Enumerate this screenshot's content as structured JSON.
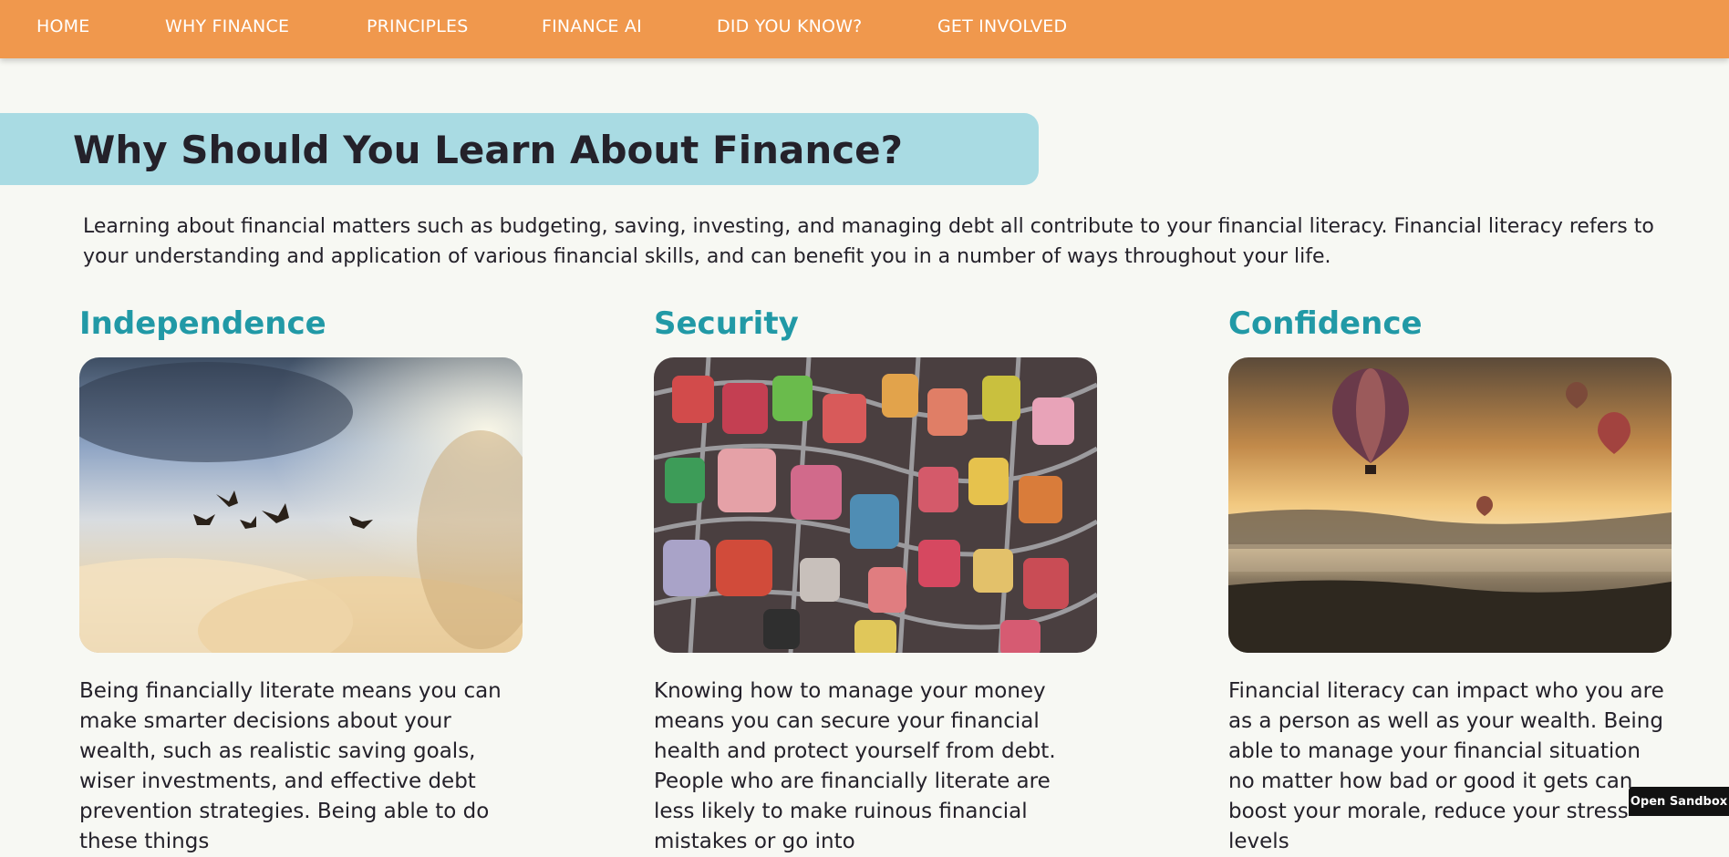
{
  "nav": {
    "items": [
      {
        "label": "HOME"
      },
      {
        "label": "WHY FINANCE"
      },
      {
        "label": "PRINCIPLES"
      },
      {
        "label": "FINANCE AI"
      },
      {
        "label": "DID YOU KNOW?"
      },
      {
        "label": "GET INVOLVED"
      }
    ]
  },
  "main": {
    "title": "Why Should You Learn About Finance?",
    "intro": "Learning about financial matters such as budgeting, saving, investing, and managing debt all contribute to your financial literacy. Financial literacy refers to your understanding and application of various financial skills, and can benefit you in a number of ways throughout your life.",
    "columns": [
      {
        "heading": "Independence",
        "image": "birds-flying-in-clouds",
        "text": "Being financially literate means you can make smarter decisions about your wealth, such as realistic saving goals, wiser investments, and effective debt prevention strategies. Being able to do these things"
      },
      {
        "heading": "Security",
        "image": "love-padlocks-on-fence",
        "text": "Knowing how to manage your money means you can secure your financial health and protect yourself from debt. People who are financially literate are less likely to make ruinous financial mistakes or go into"
      },
      {
        "heading": "Confidence",
        "image": "hot-air-balloons-at-sunrise",
        "text": "Financial literacy can impact who you are as a person as well as your wealth. Being able to manage your financial situation no matter how bad or good it gets can boost your morale, reduce your stress levels"
      }
    ]
  },
  "sandbox": {
    "label": "Open Sandbox"
  },
  "colors": {
    "nav_bg": "#f0984d",
    "banner_bg": "#a9dbe3",
    "heading_teal": "#2199a6",
    "page_bg": "#f7f8f3"
  }
}
